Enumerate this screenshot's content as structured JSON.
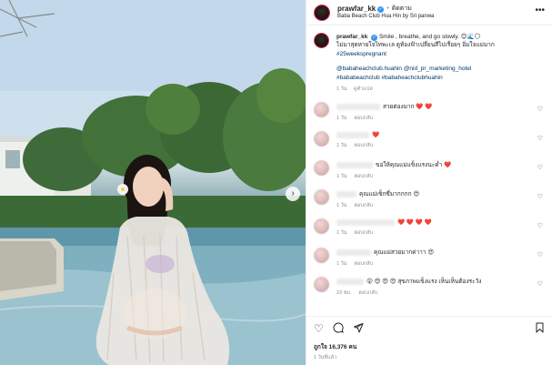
{
  "header": {
    "username": "prawfar_kk",
    "follow_label": "ติดตาม",
    "location": "Baba Beach Club Hua Hin by Sri panwa",
    "more_icon": "more-horizontal-icon"
  },
  "caption": {
    "username": "prawfar_kk",
    "line1": "Smile , breathe, and go slowly. 😊🌊🌕",
    "line2": "ไม่มาสุดหายใจไทพะเล ดูท้องฟ้าเปลี่ยนสีไปเรื่อยๆ อิ่มใจแม่มาก",
    "hashtag": "#25weekspregnant",
    "mentions": "@babaheachclub.huahin @nid_pr_marketing_hotel",
    "hashtags2": "#bababeachclub #babaheachclubhuahin",
    "time": "1 วัน",
    "translate": "ดูคำแปล"
  },
  "comments": [
    {
      "text": "สวยต่องมาก ❤️ ❤️",
      "time": "1 วัน",
      "reply": "ตอบกลับ"
    },
    {
      "text": "❤️",
      "time": "1 วัน",
      "reply": "ตอบกลับ"
    },
    {
      "text": "ขอให้คุณแม่แข็งแรงนะค่ำ ❤️",
      "time": "1 วัน",
      "reply": "ตอบกลับ"
    },
    {
      "text": "คุณแม่เซ็กซี่มากกกก 😍",
      "time": "1 วัน",
      "reply": "ตอบกลับ"
    },
    {
      "text": "❤️ ❤️ ❤️ ❤️",
      "time": "1 วัน",
      "reply": "ตอบกลับ"
    },
    {
      "text": "คุณแม่สวยมากค่าาา 😍",
      "time": "1 วัน",
      "reply": "ตอบกลับ"
    },
    {
      "text": "😮 😍 😍 😍 สุขภาพแข็งแรง เห็นเห็นต้องระวัง",
      "time": "23 ชม.",
      "reply": "ตอบกลับ"
    }
  ],
  "actions": {
    "like_icon": "heart-icon",
    "comment_icon": "comment-icon",
    "share_icon": "send-icon",
    "save_icon": "bookmark-icon",
    "likes": "ถูกใจ 16,376 คน",
    "time": "1 วันที่แล้ว"
  },
  "photo": {
    "next_icon": "chevron-right-icon"
  }
}
